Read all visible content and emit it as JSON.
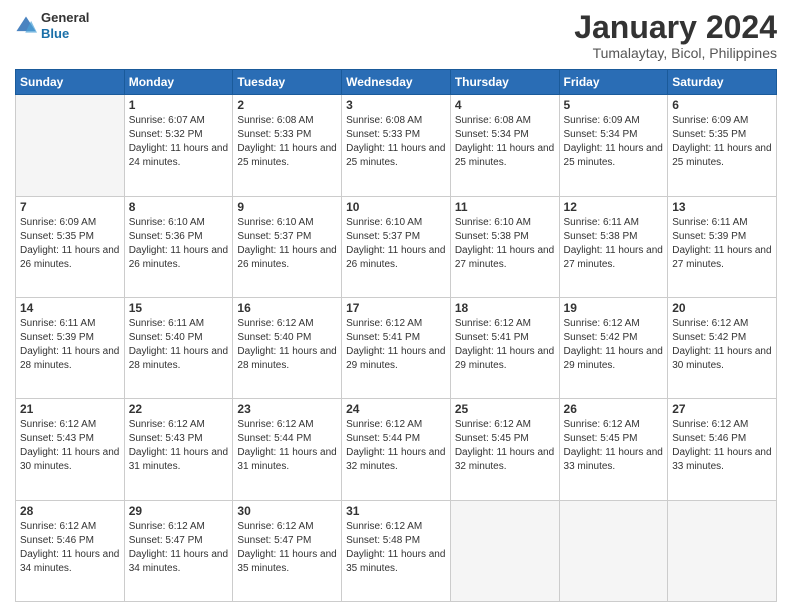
{
  "header": {
    "logo": {
      "general": "General",
      "blue": "Blue"
    },
    "title": "January 2024",
    "subtitle": "Tumalaytay, Bicol, Philippines"
  },
  "weekdays": [
    "Sunday",
    "Monday",
    "Tuesday",
    "Wednesday",
    "Thursday",
    "Friday",
    "Saturday"
  ],
  "weeks": [
    [
      {
        "day": "",
        "sunrise": "",
        "sunset": "",
        "daylight": ""
      },
      {
        "day": "1",
        "sunrise": "Sunrise: 6:07 AM",
        "sunset": "Sunset: 5:32 PM",
        "daylight": "Daylight: 11 hours and 24 minutes."
      },
      {
        "day": "2",
        "sunrise": "Sunrise: 6:08 AM",
        "sunset": "Sunset: 5:33 PM",
        "daylight": "Daylight: 11 hours and 25 minutes."
      },
      {
        "day": "3",
        "sunrise": "Sunrise: 6:08 AM",
        "sunset": "Sunset: 5:33 PM",
        "daylight": "Daylight: 11 hours and 25 minutes."
      },
      {
        "day": "4",
        "sunrise": "Sunrise: 6:08 AM",
        "sunset": "Sunset: 5:34 PM",
        "daylight": "Daylight: 11 hours and 25 minutes."
      },
      {
        "day": "5",
        "sunrise": "Sunrise: 6:09 AM",
        "sunset": "Sunset: 5:34 PM",
        "daylight": "Daylight: 11 hours and 25 minutes."
      },
      {
        "day": "6",
        "sunrise": "Sunrise: 6:09 AM",
        "sunset": "Sunset: 5:35 PM",
        "daylight": "Daylight: 11 hours and 25 minutes."
      }
    ],
    [
      {
        "day": "7",
        "sunrise": "Sunrise: 6:09 AM",
        "sunset": "Sunset: 5:35 PM",
        "daylight": "Daylight: 11 hours and 26 minutes."
      },
      {
        "day": "8",
        "sunrise": "Sunrise: 6:10 AM",
        "sunset": "Sunset: 5:36 PM",
        "daylight": "Daylight: 11 hours and 26 minutes."
      },
      {
        "day": "9",
        "sunrise": "Sunrise: 6:10 AM",
        "sunset": "Sunset: 5:37 PM",
        "daylight": "Daylight: 11 hours and 26 minutes."
      },
      {
        "day": "10",
        "sunrise": "Sunrise: 6:10 AM",
        "sunset": "Sunset: 5:37 PM",
        "daylight": "Daylight: 11 hours and 26 minutes."
      },
      {
        "day": "11",
        "sunrise": "Sunrise: 6:10 AM",
        "sunset": "Sunset: 5:38 PM",
        "daylight": "Daylight: 11 hours and 27 minutes."
      },
      {
        "day": "12",
        "sunrise": "Sunrise: 6:11 AM",
        "sunset": "Sunset: 5:38 PM",
        "daylight": "Daylight: 11 hours and 27 minutes."
      },
      {
        "day": "13",
        "sunrise": "Sunrise: 6:11 AM",
        "sunset": "Sunset: 5:39 PM",
        "daylight": "Daylight: 11 hours and 27 minutes."
      }
    ],
    [
      {
        "day": "14",
        "sunrise": "Sunrise: 6:11 AM",
        "sunset": "Sunset: 5:39 PM",
        "daylight": "Daylight: 11 hours and 28 minutes."
      },
      {
        "day": "15",
        "sunrise": "Sunrise: 6:11 AM",
        "sunset": "Sunset: 5:40 PM",
        "daylight": "Daylight: 11 hours and 28 minutes."
      },
      {
        "day": "16",
        "sunrise": "Sunrise: 6:12 AM",
        "sunset": "Sunset: 5:40 PM",
        "daylight": "Daylight: 11 hours and 28 minutes."
      },
      {
        "day": "17",
        "sunrise": "Sunrise: 6:12 AM",
        "sunset": "Sunset: 5:41 PM",
        "daylight": "Daylight: 11 hours and 29 minutes."
      },
      {
        "day": "18",
        "sunrise": "Sunrise: 6:12 AM",
        "sunset": "Sunset: 5:41 PM",
        "daylight": "Daylight: 11 hours and 29 minutes."
      },
      {
        "day": "19",
        "sunrise": "Sunrise: 6:12 AM",
        "sunset": "Sunset: 5:42 PM",
        "daylight": "Daylight: 11 hours and 29 minutes."
      },
      {
        "day": "20",
        "sunrise": "Sunrise: 6:12 AM",
        "sunset": "Sunset: 5:42 PM",
        "daylight": "Daylight: 11 hours and 30 minutes."
      }
    ],
    [
      {
        "day": "21",
        "sunrise": "Sunrise: 6:12 AM",
        "sunset": "Sunset: 5:43 PM",
        "daylight": "Daylight: 11 hours and 30 minutes."
      },
      {
        "day": "22",
        "sunrise": "Sunrise: 6:12 AM",
        "sunset": "Sunset: 5:43 PM",
        "daylight": "Daylight: 11 hours and 31 minutes."
      },
      {
        "day": "23",
        "sunrise": "Sunrise: 6:12 AM",
        "sunset": "Sunset: 5:44 PM",
        "daylight": "Daylight: 11 hours and 31 minutes."
      },
      {
        "day": "24",
        "sunrise": "Sunrise: 6:12 AM",
        "sunset": "Sunset: 5:44 PM",
        "daylight": "Daylight: 11 hours and 32 minutes."
      },
      {
        "day": "25",
        "sunrise": "Sunrise: 6:12 AM",
        "sunset": "Sunset: 5:45 PM",
        "daylight": "Daylight: 11 hours and 32 minutes."
      },
      {
        "day": "26",
        "sunrise": "Sunrise: 6:12 AM",
        "sunset": "Sunset: 5:45 PM",
        "daylight": "Daylight: 11 hours and 33 minutes."
      },
      {
        "day": "27",
        "sunrise": "Sunrise: 6:12 AM",
        "sunset": "Sunset: 5:46 PM",
        "daylight": "Daylight: 11 hours and 33 minutes."
      }
    ],
    [
      {
        "day": "28",
        "sunrise": "Sunrise: 6:12 AM",
        "sunset": "Sunset: 5:46 PM",
        "daylight": "Daylight: 11 hours and 34 minutes."
      },
      {
        "day": "29",
        "sunrise": "Sunrise: 6:12 AM",
        "sunset": "Sunset: 5:47 PM",
        "daylight": "Daylight: 11 hours and 34 minutes."
      },
      {
        "day": "30",
        "sunrise": "Sunrise: 6:12 AM",
        "sunset": "Sunset: 5:47 PM",
        "daylight": "Daylight: 11 hours and 35 minutes."
      },
      {
        "day": "31",
        "sunrise": "Sunrise: 6:12 AM",
        "sunset": "Sunset: 5:48 PM",
        "daylight": "Daylight: 11 hours and 35 minutes."
      },
      {
        "day": "",
        "sunrise": "",
        "sunset": "",
        "daylight": ""
      },
      {
        "day": "",
        "sunrise": "",
        "sunset": "",
        "daylight": ""
      },
      {
        "day": "",
        "sunrise": "",
        "sunset": "",
        "daylight": ""
      }
    ]
  ]
}
